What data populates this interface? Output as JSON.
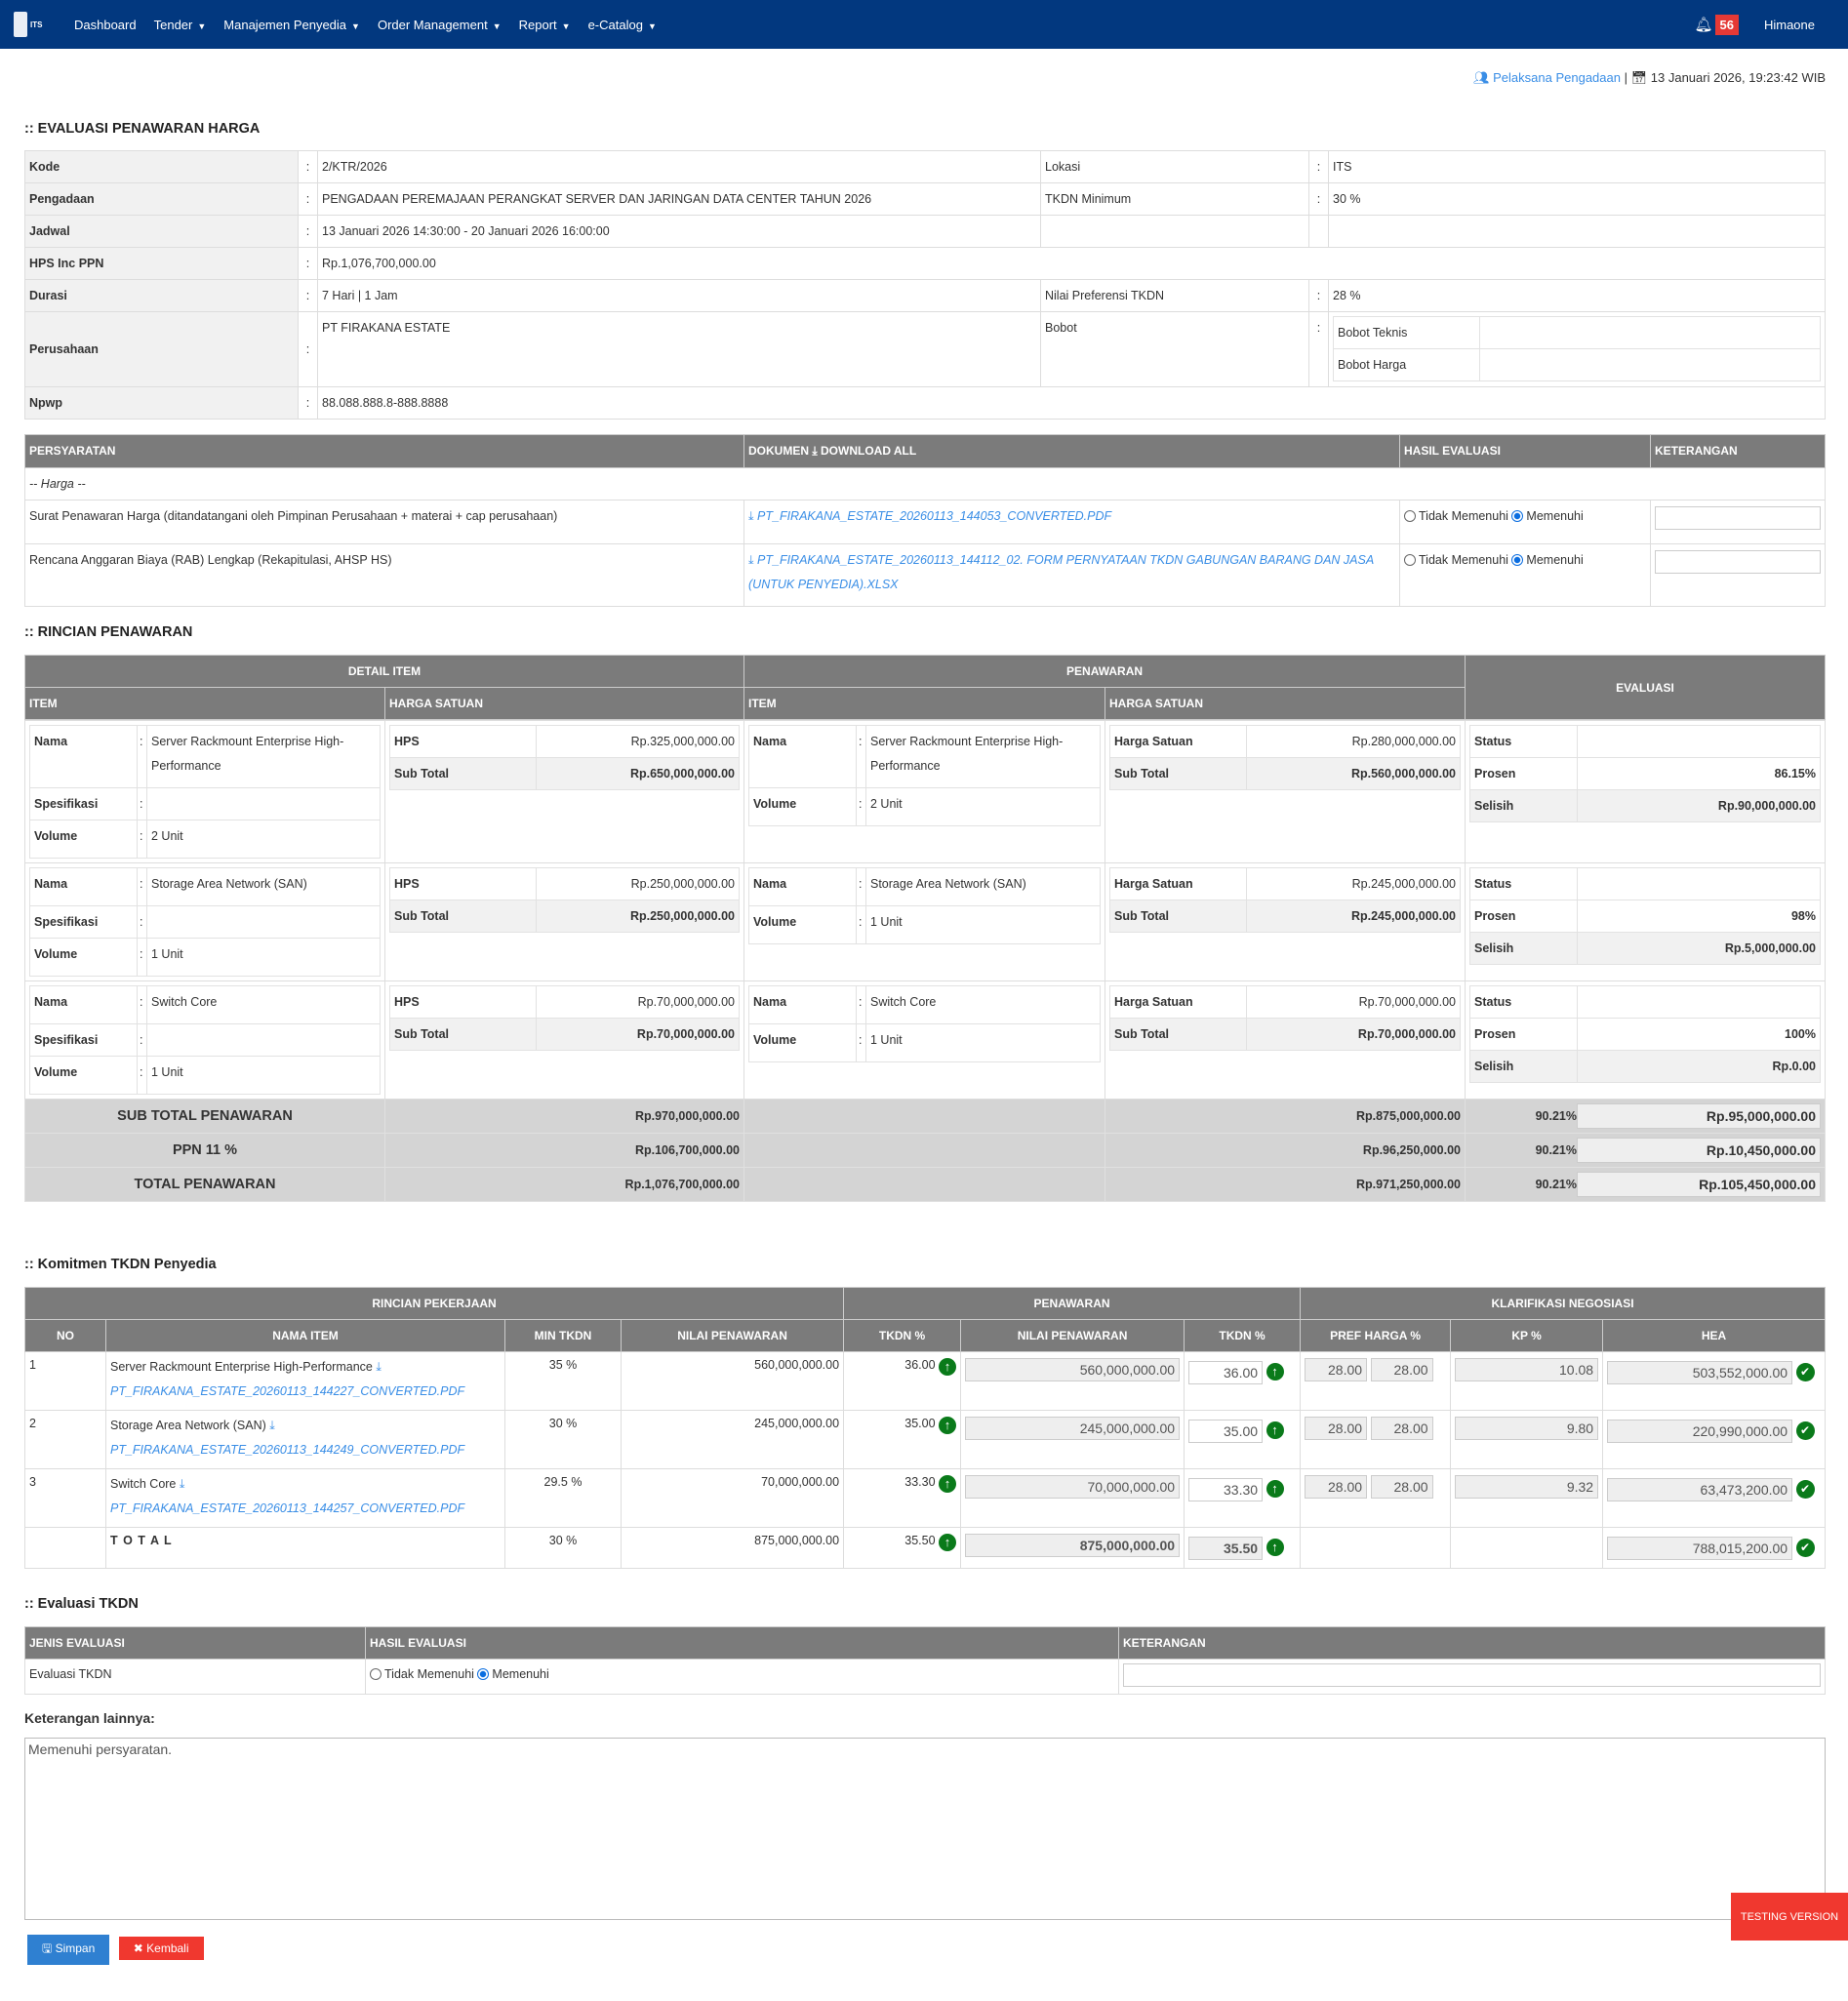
{
  "nav": {
    "logo_text": "ITS",
    "items": [
      "Dashboard",
      "Tender",
      "Manajemen Penyedia",
      "Order Management",
      "Report",
      "e-Catalog"
    ],
    "notif_count": "56",
    "user": "Himaone"
  },
  "topinfo": {
    "role": "Pelaksana Pengadaan",
    "sep": "|",
    "datetime": "13 Januari 2026, 19:23:42 WIB"
  },
  "section1": {
    "title": ":: EVALUASI PENAWARAN HARGA",
    "kode_l": "Kode",
    "kode": "2/KTR/2026",
    "lokasi_l": "Lokasi",
    "lokasi": "ITS",
    "pengadaan_l": "Pengadaan",
    "pengadaan": "PENGADAAN PEREMAJAAN PERANGKAT SERVER DAN JARINGAN DATA CENTER TAHUN 2026",
    "tkdn_l": "TKDN Minimum",
    "tkdn": "30 %",
    "jadwal_l": "Jadwal",
    "jadwal": "13 Januari 2026 14:30:00 - 20 Januari 2026 16:00:00",
    "hps_l": "HPS Inc PPN",
    "hps": "Rp.1,076,700,000.00",
    "durasi_l": "Durasi",
    "durasi": "7 Hari | 1 Jam",
    "pref_l": "Nilai Preferensi TKDN",
    "pref": "28 %",
    "perusahaan_l": "Perusahaan",
    "perusahaan": "PT FIRAKANA ESTATE",
    "bobot_l": "Bobot",
    "bobot_teknis": "Bobot Teknis",
    "bobot_harga": "Bobot Harga",
    "npwp_l": "Npwp",
    "npwp": "88.088.888.8-888.8888",
    "colon": ":"
  },
  "persyaratan": {
    "h_syarat": "PERSYARATAN",
    "h_dok": "DOKUMEN",
    "h_download": "DOWNLOAD ALL",
    "h_hasil": "HASIL EVALUASI",
    "h_ket": "KETERANGAN",
    "group": "-- Harga --",
    "opt_no": "Tidak Memenuhi",
    "opt_yes": "Memenuhi",
    "rows": [
      {
        "name": "Surat Penawaran Harga (ditandatangani oleh Pimpinan Perusahaan + materai + cap perusahaan)",
        "file": "PT_FIRAKANA_ESTATE_20260113_144053_CONVERTED.PDF"
      },
      {
        "name": "Rencana Anggaran Biaya (RAB) Lengkap (Rekapitulasi, AHSP HS)",
        "file": "PT_FIRAKANA_ESTATE_20260113_144112_02. FORM PERNYATAAN TKDN GABUNGAN BARANG DAN JASA (UNTUK PENYEDIA).XLSX"
      }
    ]
  },
  "rincian": {
    "title": ":: RINCIAN PENAWARAN",
    "h_detail": "DETAIL ITEM",
    "h_penawaran": "PENAWARAN",
    "h_evaluasi": "EVALUASI",
    "h_item": "ITEM",
    "h_harga": "HARGA SATUAN",
    "l_nama": "Nama",
    "l_spek": "Spesifikasi",
    "l_volume": "Volume",
    "l_hps": "HPS",
    "l_subtotal": "Sub Total",
    "l_harga": "Harga Satuan",
    "l_status": "Status",
    "l_prosen": "Prosen",
    "l_selisih": "Selisih",
    "items": [
      {
        "nama": "Server Rackmount Enterprise High-Performance",
        "volume": "2 Unit",
        "hps": "Rp.325,000,000.00",
        "hps_sub": "Rp.650,000,000.00",
        "harga": "Rp.280,000,000.00",
        "sub": "Rp.560,000,000.00",
        "prosen": "86.15%",
        "selisih": "Rp.90,000,000.00"
      },
      {
        "nama": "Storage Area Network (SAN)",
        "volume": "1 Unit",
        "hps": "Rp.250,000,000.00",
        "hps_sub": "Rp.250,000,000.00",
        "harga": "Rp.245,000,000.00",
        "sub": "Rp.245,000,000.00",
        "prosen": "98%",
        "selisih": "Rp.5,000,000.00"
      },
      {
        "nama": "Switch Core",
        "volume": "1 Unit",
        "hps": "Rp.70,000,000.00",
        "hps_sub": "Rp.70,000,000.00",
        "harga": "Rp.70,000,000.00",
        "sub": "Rp.70,000,000.00",
        "prosen": "100%",
        "selisih": "Rp.0.00"
      }
    ],
    "totals": [
      {
        "label": "SUB TOTAL PENAWARAN",
        "hps": "Rp.970,000,000.00",
        "pen": "Rp.875,000,000.00",
        "pct": "90.21%",
        "selisih": "Rp.95,000,000.00"
      },
      {
        "label": "PPN 11 %",
        "hps": "Rp.106,700,000.00",
        "pen": "Rp.96,250,000.00",
        "pct": "90.21%",
        "selisih": "Rp.10,450,000.00"
      },
      {
        "label": "TOTAL PENAWARAN",
        "hps": "Rp.1,076,700,000.00",
        "pen": "Rp.971,250,000.00",
        "pct": "90.21%",
        "selisih": "Rp.105,450,000.00"
      }
    ]
  },
  "komitmen": {
    "title": ":: Komitmen TKDN Penyedia",
    "h_rincian": "RINCIAN PEKERJAAN",
    "h_penawaran": "PENAWARAN",
    "h_klar": "KLARIFIKASI NEGOSIASI",
    "cols": [
      "NO",
      "NAMA ITEM",
      "MIN TKDN",
      "NILAI PENAWARAN",
      "TKDN %",
      "NILAI PENAWARAN",
      "TKDN %",
      "PREF HARGA %",
      "KP %",
      "HEA"
    ],
    "rows": [
      {
        "no": "1",
        "nama": "Server Rackmount Enterprise High-Performance",
        "file": "PT_FIRAKANA_ESTATE_20260113_144227_CONVERTED.PDF",
        "min": "35 %",
        "nilai": "560,000,000.00",
        "tkdn": "36.00",
        "nilai2": "560,000,000.00",
        "tkdn2": "36.00",
        "pref1": "28.00",
        "pref2": "28.00",
        "kp": "10.08",
        "hea": "503,552,000.00"
      },
      {
        "no": "2",
        "nama": "Storage Area Network (SAN)",
        "file": "PT_FIRAKANA_ESTATE_20260113_144249_CONVERTED.PDF",
        "min": "30 %",
        "nilai": "245,000,000.00",
        "tkdn": "35.00",
        "nilai2": "245,000,000.00",
        "tkdn2": "35.00",
        "pref1": "28.00",
        "pref2": "28.00",
        "kp": "9.80",
        "hea": "220,990,000.00"
      },
      {
        "no": "3",
        "nama": "Switch Core",
        "file": "PT_FIRAKANA_ESTATE_20260113_144257_CONVERTED.PDF",
        "min": "29.5 %",
        "nilai": "70,000,000.00",
        "tkdn": "33.30",
        "nilai2": "70,000,000.00",
        "tkdn2": "33.30",
        "pref1": "28.00",
        "pref2": "28.00",
        "kp": "9.32",
        "hea": "63,473,200.00"
      }
    ],
    "total": {
      "label": "T O T A L",
      "min": "30 %",
      "nilai": "875,000,000.00",
      "tkdn": "35.50",
      "nilai2": "875,000,000.00",
      "tkdn2": "35.50",
      "hea": "788,015,200.00"
    }
  },
  "evaltkdn": {
    "title": ":: Evaluasi TKDN",
    "h_jenis": "JENIS EVALUASI",
    "h_hasil": "HASIL EVALUASI",
    "h_ket": "KETERANGAN",
    "jenis": "Evaluasi TKDN",
    "opt_no": "Tidak Memenuhi",
    "opt_yes": "Memenuhi"
  },
  "ket": {
    "label": "Keterangan lainnya:",
    "value": "Memenuhi persyaratan."
  },
  "buttons": {
    "save": "Simpan",
    "back": "Kembali"
  },
  "testing": "TESTING VERSION"
}
